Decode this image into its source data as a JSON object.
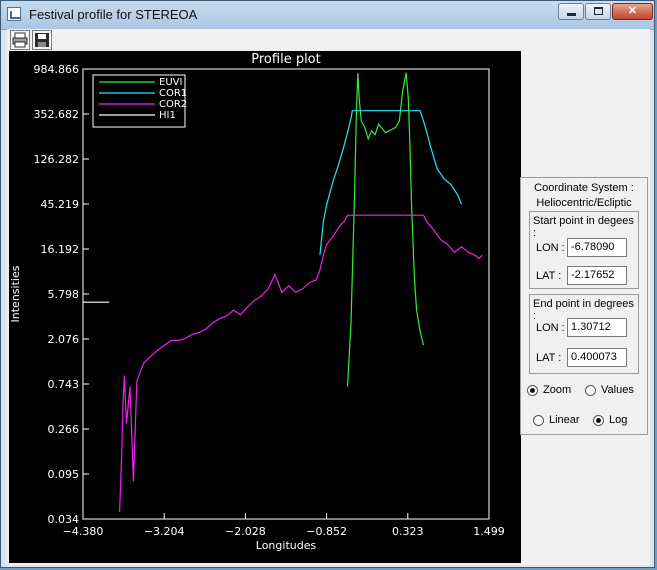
{
  "window": {
    "title": "Festival profile for STEREOA",
    "icon": "app-icon",
    "controls": [
      "minimize",
      "maximize",
      "close"
    ],
    "control_glyphs": {
      "close": "✕"
    }
  },
  "toolbar": {
    "buttons": [
      {
        "icon": "print-icon",
        "label": ""
      },
      {
        "icon": "save-icon",
        "label": ""
      }
    ]
  },
  "side_panel": {
    "coordinate_system_label": "Coordinate System :",
    "coordinate_system_value": "Heliocentric/Ecliptic",
    "start": {
      "heading": "Start point in degees :",
      "lon_label": "LON :",
      "lon": "-6.78090",
      "lat_label": "LAT :",
      "lat": "-2.17652"
    },
    "end": {
      "heading": "End point in degrees :",
      "lon_label": "LON :",
      "lon": "1.30712",
      "lat_label": "LAT :",
      "lat": "0.400073"
    },
    "mode_options": [
      {
        "label": "Zoom",
        "selected": true
      },
      {
        "label": "Values",
        "selected": false
      }
    ],
    "scale_options": [
      {
        "label": "Linear",
        "selected": false
      },
      {
        "label": "Log",
        "selected": true
      }
    ]
  },
  "chart_data": {
    "type": "line",
    "title": "Profile plot",
    "xlabel": "Longitudes",
    "ylabel": "Intensities",
    "y_scale": "log",
    "xlim": [
      -4.38,
      1.499
    ],
    "ylim": [
      0.034,
      984.866
    ],
    "x_ticks": [
      "−4.380",
      "−3.204",
      "−2.028",
      "−0.852",
      "0.323",
      "1.499"
    ],
    "y_ticks": [
      "984.866",
      "352.682",
      "126.282",
      "45.219",
      "16.192",
      "5.798",
      "2.076",
      "0.743",
      "0.266",
      "0.095",
      "0.034"
    ],
    "background": "#000000",
    "legend": {
      "placement": "top-left"
    },
    "series": [
      {
        "name": "EUVI",
        "color": "#33ee33",
        "x": [
          -0.55,
          -0.5,
          -0.45,
          -0.42,
          -0.4,
          -0.38,
          -0.35,
          -0.3,
          -0.25,
          -0.2,
          -0.15,
          -0.1,
          0.0,
          0.1,
          0.15,
          0.2,
          0.25,
          0.3,
          0.33,
          0.35,
          0.38,
          0.42,
          0.45,
          0.5,
          0.55
        ],
        "y": [
          0.7,
          3,
          50,
          400,
          900,
          500,
          300,
          260,
          200,
          240,
          220,
          280,
          230,
          250,
          260,
          300,
          600,
          900,
          500,
          200,
          40,
          8,
          4,
          2.5,
          1.8
        ]
      },
      {
        "name": "COR1",
        "color": "#22e8ee",
        "x": [
          -0.95,
          -0.9,
          -0.85,
          -0.8,
          -0.75,
          -0.7,
          -0.65,
          -0.6,
          -0.55,
          -0.5,
          -0.48,
          0.5,
          0.55,
          0.6,
          0.65,
          0.7,
          0.75,
          0.8,
          0.85,
          0.9,
          0.95,
          1.0,
          1.05,
          1.1
        ],
        "y": [
          14,
          30,
          45,
          60,
          80,
          100,
          130,
          170,
          230,
          320,
          380,
          380,
          300,
          230,
          170,
          130,
          100,
          90,
          80,
          75,
          70,
          62,
          55,
          45
        ]
      },
      {
        "name": "COR2",
        "color": "#ee22ee",
        "x": [
          -3.85,
          -3.82,
          -3.8,
          -3.78,
          -3.75,
          -3.7,
          -3.65,
          -3.6,
          -3.5,
          -3.4,
          -3.3,
          -3.2,
          -3.1,
          -3.0,
          -2.9,
          -2.8,
          -2.7,
          -2.6,
          -2.5,
          -2.4,
          -2.3,
          -2.2,
          -2.1,
          -2.0,
          -1.9,
          -1.8,
          -1.7,
          -1.6,
          -1.5,
          -1.4,
          -1.3,
          -1.2,
          -1.1,
          -1.0,
          -0.95,
          -0.9,
          -0.85,
          -0.8,
          -0.75,
          -0.7,
          -0.65,
          -0.6,
          -0.55,
          0.55,
          0.6,
          0.7,
          0.8,
          0.9,
          1.0,
          1.1,
          1.2,
          1.3,
          1.35,
          1.4
        ],
        "y": [
          0.04,
          0.15,
          0.5,
          0.9,
          0.3,
          0.7,
          0.08,
          0.8,
          1.2,
          1.4,
          1.6,
          1.8,
          2.0,
          2.0,
          2.1,
          2.3,
          2.4,
          2.6,
          3.0,
          3.3,
          3.5,
          4.0,
          3.6,
          4.3,
          5.0,
          5.5,
          6.5,
          9,
          6,
          7,
          6,
          6.5,
          7.5,
          8,
          10,
          14,
          18,
          20,
          22,
          25,
          28,
          30,
          35,
          35,
          30,
          25,
          20,
          18,
          15,
          17,
          15,
          14,
          13,
          14
        ]
      },
      {
        "name": "HI1",
        "color": "#ffffff",
        "x": [
          -4.38,
          -4.0
        ],
        "y": [
          4.8,
          4.8
        ]
      }
    ]
  }
}
